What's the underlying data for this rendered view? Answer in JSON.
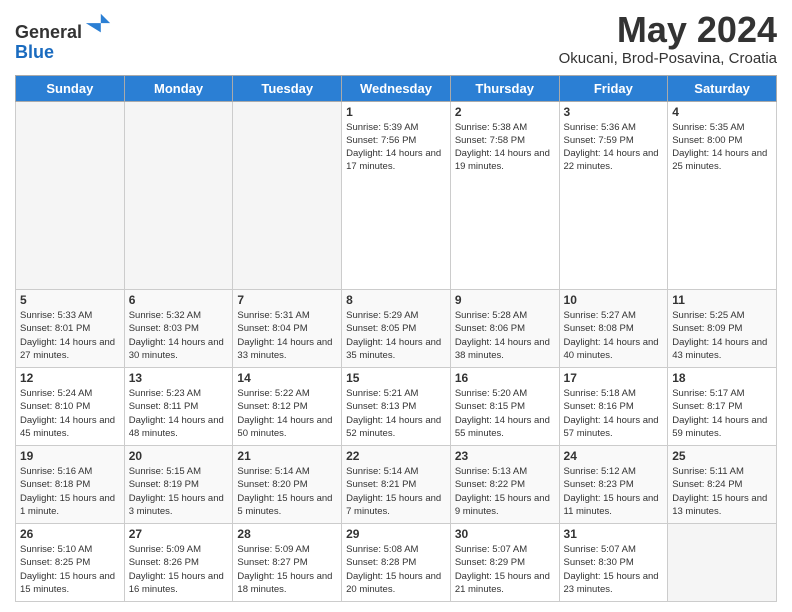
{
  "header": {
    "logo_line1": "General",
    "logo_line2": "Blue",
    "month_title": "May 2024",
    "location": "Okucani, Brod-Posavina, Croatia"
  },
  "days_of_week": [
    "Sunday",
    "Monday",
    "Tuesday",
    "Wednesday",
    "Thursday",
    "Friday",
    "Saturday"
  ],
  "weeks": [
    [
      {
        "day": "",
        "info": ""
      },
      {
        "day": "",
        "info": ""
      },
      {
        "day": "",
        "info": ""
      },
      {
        "day": "1",
        "info": "Sunrise: 5:39 AM\nSunset: 7:56 PM\nDaylight: 14 hours and 17 minutes."
      },
      {
        "day": "2",
        "info": "Sunrise: 5:38 AM\nSunset: 7:58 PM\nDaylight: 14 hours and 19 minutes."
      },
      {
        "day": "3",
        "info": "Sunrise: 5:36 AM\nSunset: 7:59 PM\nDaylight: 14 hours and 22 minutes."
      },
      {
        "day": "4",
        "info": "Sunrise: 5:35 AM\nSunset: 8:00 PM\nDaylight: 14 hours and 25 minutes."
      }
    ],
    [
      {
        "day": "5",
        "info": "Sunrise: 5:33 AM\nSunset: 8:01 PM\nDaylight: 14 hours and 27 minutes."
      },
      {
        "day": "6",
        "info": "Sunrise: 5:32 AM\nSunset: 8:03 PM\nDaylight: 14 hours and 30 minutes."
      },
      {
        "day": "7",
        "info": "Sunrise: 5:31 AM\nSunset: 8:04 PM\nDaylight: 14 hours and 33 minutes."
      },
      {
        "day": "8",
        "info": "Sunrise: 5:29 AM\nSunset: 8:05 PM\nDaylight: 14 hours and 35 minutes."
      },
      {
        "day": "9",
        "info": "Sunrise: 5:28 AM\nSunset: 8:06 PM\nDaylight: 14 hours and 38 minutes."
      },
      {
        "day": "10",
        "info": "Sunrise: 5:27 AM\nSunset: 8:08 PM\nDaylight: 14 hours and 40 minutes."
      },
      {
        "day": "11",
        "info": "Sunrise: 5:25 AM\nSunset: 8:09 PM\nDaylight: 14 hours and 43 minutes."
      }
    ],
    [
      {
        "day": "12",
        "info": "Sunrise: 5:24 AM\nSunset: 8:10 PM\nDaylight: 14 hours and 45 minutes."
      },
      {
        "day": "13",
        "info": "Sunrise: 5:23 AM\nSunset: 8:11 PM\nDaylight: 14 hours and 48 minutes."
      },
      {
        "day": "14",
        "info": "Sunrise: 5:22 AM\nSunset: 8:12 PM\nDaylight: 14 hours and 50 minutes."
      },
      {
        "day": "15",
        "info": "Sunrise: 5:21 AM\nSunset: 8:13 PM\nDaylight: 14 hours and 52 minutes."
      },
      {
        "day": "16",
        "info": "Sunrise: 5:20 AM\nSunset: 8:15 PM\nDaylight: 14 hours and 55 minutes."
      },
      {
        "day": "17",
        "info": "Sunrise: 5:18 AM\nSunset: 8:16 PM\nDaylight: 14 hours and 57 minutes."
      },
      {
        "day": "18",
        "info": "Sunrise: 5:17 AM\nSunset: 8:17 PM\nDaylight: 14 hours and 59 minutes."
      }
    ],
    [
      {
        "day": "19",
        "info": "Sunrise: 5:16 AM\nSunset: 8:18 PM\nDaylight: 15 hours and 1 minute."
      },
      {
        "day": "20",
        "info": "Sunrise: 5:15 AM\nSunset: 8:19 PM\nDaylight: 15 hours and 3 minutes."
      },
      {
        "day": "21",
        "info": "Sunrise: 5:14 AM\nSunset: 8:20 PM\nDaylight: 15 hours and 5 minutes."
      },
      {
        "day": "22",
        "info": "Sunrise: 5:14 AM\nSunset: 8:21 PM\nDaylight: 15 hours and 7 minutes."
      },
      {
        "day": "23",
        "info": "Sunrise: 5:13 AM\nSunset: 8:22 PM\nDaylight: 15 hours and 9 minutes."
      },
      {
        "day": "24",
        "info": "Sunrise: 5:12 AM\nSunset: 8:23 PM\nDaylight: 15 hours and 11 minutes."
      },
      {
        "day": "25",
        "info": "Sunrise: 5:11 AM\nSunset: 8:24 PM\nDaylight: 15 hours and 13 minutes."
      }
    ],
    [
      {
        "day": "26",
        "info": "Sunrise: 5:10 AM\nSunset: 8:25 PM\nDaylight: 15 hours and 15 minutes."
      },
      {
        "day": "27",
        "info": "Sunrise: 5:09 AM\nSunset: 8:26 PM\nDaylight: 15 hours and 16 minutes."
      },
      {
        "day": "28",
        "info": "Sunrise: 5:09 AM\nSunset: 8:27 PM\nDaylight: 15 hours and 18 minutes."
      },
      {
        "day": "29",
        "info": "Sunrise: 5:08 AM\nSunset: 8:28 PM\nDaylight: 15 hours and 20 minutes."
      },
      {
        "day": "30",
        "info": "Sunrise: 5:07 AM\nSunset: 8:29 PM\nDaylight: 15 hours and 21 minutes."
      },
      {
        "day": "31",
        "info": "Sunrise: 5:07 AM\nSunset: 8:30 PM\nDaylight: 15 hours and 23 minutes."
      },
      {
        "day": "",
        "info": ""
      }
    ]
  ]
}
